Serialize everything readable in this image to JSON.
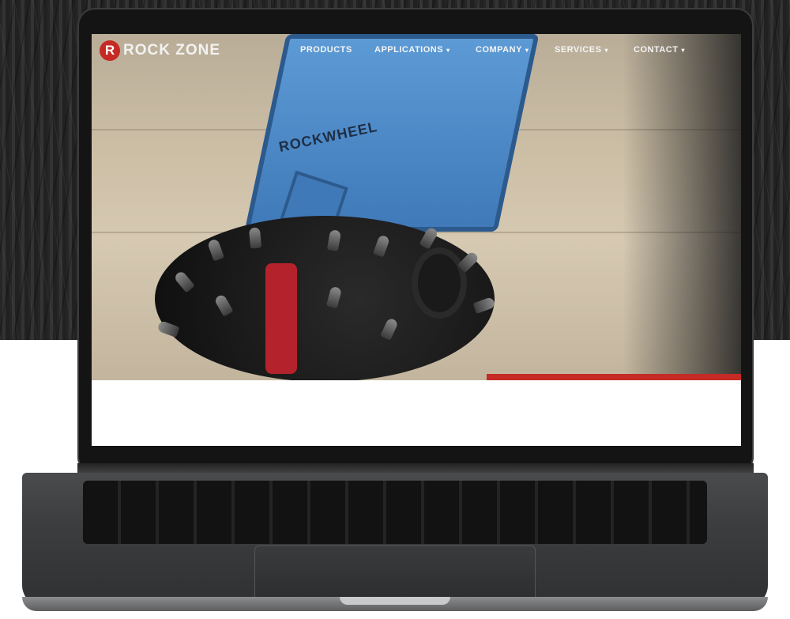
{
  "site": {
    "logo_mark": "R",
    "logo_text": "ROCK ZONE"
  },
  "nav": {
    "items": [
      {
        "label": "PRODUCTS",
        "has_dropdown": false
      },
      {
        "label": "APPLICATIONS",
        "has_dropdown": true
      },
      {
        "label": "COMPANY",
        "has_dropdown": true
      },
      {
        "label": "SERVICES",
        "has_dropdown": true
      },
      {
        "label": "CONTACT",
        "has_dropdown": true
      }
    ],
    "dropdown_glyph": "▾"
  },
  "hero": {
    "machine_label": "ROCKWHEEL"
  },
  "colors": {
    "brand_red": "#c52a24",
    "machine_blue": "#3f79b8"
  }
}
